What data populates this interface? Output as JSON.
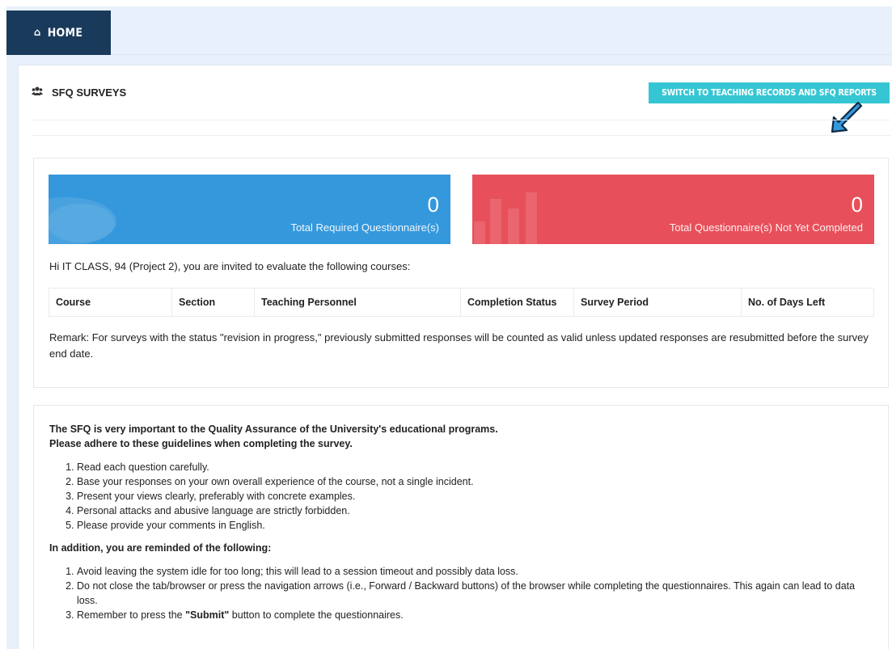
{
  "nav": {
    "home_label": "HOME"
  },
  "panel": {
    "title": "SFQ SURVEYS",
    "switch_button": "SWITCH TO TEACHING RECORDS AND SFQ REPORTS"
  },
  "stats": {
    "required": {
      "value": "0",
      "label": "Total Required Questionnaire(s)",
      "color": "#3598dc"
    },
    "not_completed": {
      "value": "0",
      "label": "Total Questionnaire(s) Not Yet Completed",
      "color": "#e7505a"
    }
  },
  "invite_text": "Hi IT CLASS, 94 (Project 2), you are invited to evaluate the following courses:",
  "table": {
    "columns": [
      "Course",
      "Section",
      "Teaching Personnel",
      "Completion Status",
      "Survey Period",
      "No. of Days Left"
    ]
  },
  "remark": "Remark: For surveys with the status \"revision in progress,\" previously submitted responses will be counted as valid unless updated responses are resubmitted before the survey end date.",
  "guidelines": {
    "intro_line1": "The SFQ is very important to the Quality Assurance of the University's educational programs.",
    "intro_line2": "Please adhere to these guidelines when completing the survey.",
    "items": [
      "Read each question carefully.",
      "Base your responses on your own overall experience of the course, not a single incident.",
      "Present your views clearly, preferably with concrete examples.",
      "Personal attacks and abusive language are strictly forbidden.",
      "Please provide your comments in English."
    ],
    "reminder_heading": "In addition, you are reminded of the following:",
    "reminders": [
      "Avoid leaving the system idle for too long; this will lead to a session timeout and possibly data loss.",
      "Do not close the tab/browser or press the navigation arrows (i.e., Forward / Backward buttons) of the browser while completing the questionnaires. This again can lead to data loss."
    ],
    "reminder3_before": "Remember to press the ",
    "reminder3_bold": "\"Submit\"",
    "reminder3_after": " button to complete the questionnaires."
  },
  "colors": {
    "nav_bg": "#1a3a5c",
    "accent": "#36c6d3",
    "arrow": "#3598dc"
  }
}
